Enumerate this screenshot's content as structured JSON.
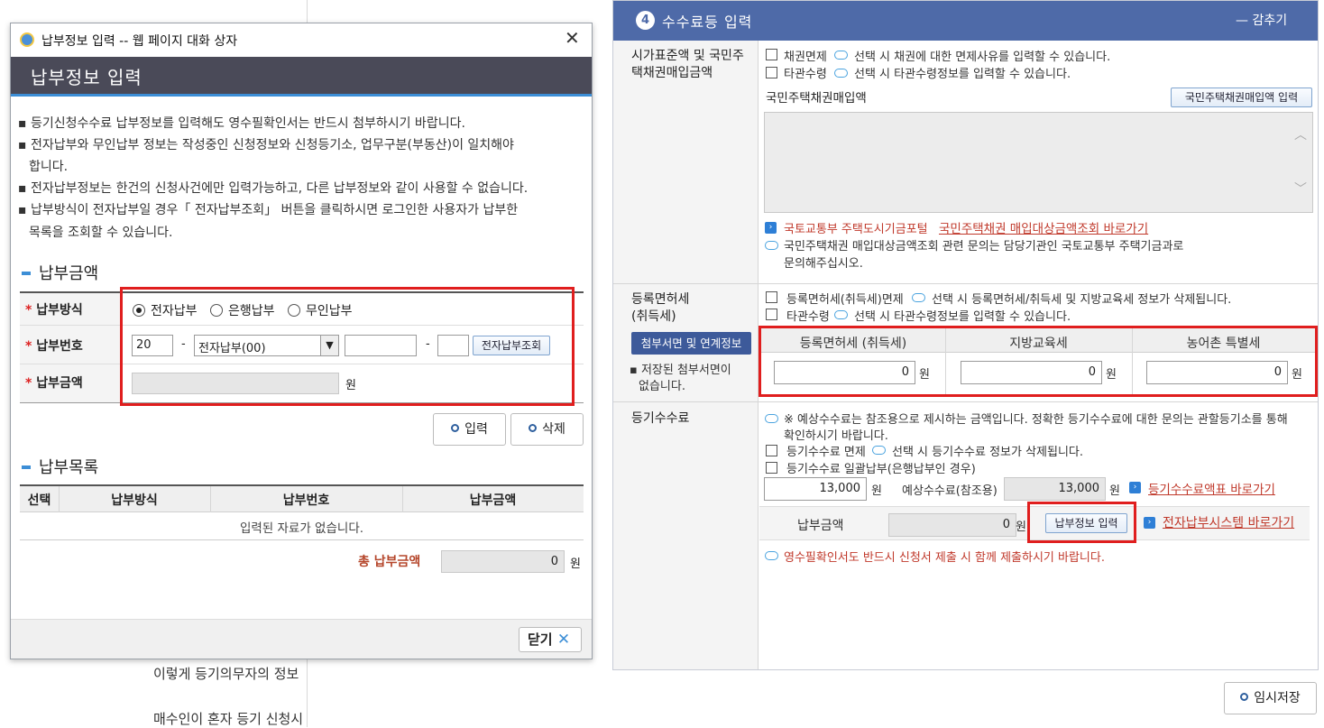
{
  "background": {
    "line1": "이렇게 등기의무자의 정보",
    "line2": "매수인이 혼자 등기 신청시"
  },
  "panel": {
    "step_number": "4",
    "title": "수수료등 입력",
    "collapse": "— 감추기",
    "sec1": {
      "label": "시가표준액 및 국민주택채권매입금액",
      "opt1": "채권면제",
      "opt1_desc": "선택 시 채권에 대한 면제사유를 입력할 수 있습니다.",
      "opt2": "타관수령",
      "opt2_desc": "선택 시 타관수령정보를 입력할 수 있습니다.",
      "sub_label": "국민주택채권매입액",
      "input_btn": "국민주택채권매입액 입력",
      "link_prefix": "국토교통부 주택도시기금포털",
      "link": "국민주택채권 매입대상금액조회 바로가기",
      "note1": "국민주택채권 매입대상금액조회 관련 문의는 담당기관인 국토교통부 주택기금과로",
      "note2": "문의해주십시오."
    },
    "sec2": {
      "label1": "등록면허세",
      "label2": "(취득세)",
      "opt1": "등록면허세(취득세)면제",
      "opt1_desc": "선택 시 등록면허세/취득세 및 지방교육세 정보가 삭제됩니다.",
      "opt2": "타관수령",
      "opt2_desc": "선택 시 타관수령정보를 입력할 수 있습니다.",
      "attach_btn": "첨부서면 및 연계정보",
      "saved_note1": "저장된 첨부서면이",
      "saved_note2": "없습니다.",
      "headers": [
        "등록면허세 (취득세)",
        "지방교육세",
        "농어촌 특별세"
      ],
      "values": [
        "0",
        "0",
        "0"
      ],
      "unit": "원"
    },
    "sec3": {
      "label": "등기수수료",
      "note1": "※ 예상수수료는 참조용으로 제시하는 금액입니다. 정확한 등기수수료에 대한 문의는 관할등기소를 통해",
      "note2": "확인하시기 바랍니다.",
      "opt1": "등기수수료 면제",
      "opt1_desc": "선택 시 등기수수료 정보가 삭제됩니다.",
      "opt2": "등기수수료 일괄납부(은행납부인 경우)",
      "fee_value": "13,000",
      "unit": "원",
      "expected_label": "예상수수료(참조용)",
      "expected_value": "13,000",
      "fee_table_link": "등기수수료액표 바로가기",
      "pay_label": "납부금액",
      "pay_value": "0",
      "pay_btn": "납부정보 입력",
      "epay_link": "전자납부시스템 바로가기",
      "bottom_note": "영수필확인서도 반드시 신청서 제출 시 함께 제출하시기 바랍니다."
    },
    "temp_save": "임시저장"
  },
  "dialog": {
    "window_title": "납부정보 입력 -- 웹 페이지 대화 상자",
    "header": "납부정보 입력",
    "bullets": [
      "등기신청수수료 납부정보를 입력해도 영수필확인서는 반드시 첨부하시기 바랍니다.",
      "전자납부와 무인납부 정보는 작성중인 신청정보와 신청등기소, 업무구분(부동산)이 일치해야",
      "합니다.",
      "전자납부정보는 한건의 신청사건에만 입력가능하고, 다른 납부정보와 같이 사용할 수 없습니다.",
      "납부방식이 전자납부일 경우「 전자납부조회」 버튼을 클릭하시면 로그인한 사용자가 납부한",
      "목록을 조회할 수 있습니다."
    ],
    "section1": "납부금액",
    "method_label": "납부방식",
    "methods": [
      "전자납부",
      "은행납부",
      "무인납부"
    ],
    "number_label": "납부번호",
    "number_prefix": "20",
    "number_select": "전자납부(00)",
    "lookup_btn": "전자납부조회",
    "amount_label": "납부금액",
    "amount_unit": "원",
    "btn_input": "입력",
    "btn_delete": "삭제",
    "section2": "납부목록",
    "list_headers": [
      "선택",
      "납부방식",
      "납부번호",
      "납부금액"
    ],
    "list_empty": "입력된 자료가 없습니다.",
    "total_label": "총 납부금액",
    "total_value": "0",
    "total_unit": "원",
    "close": "닫기"
  },
  "colors": {
    "header_blue": "#4e6aa8",
    "highlight_red": "#e01e1e",
    "dialog_bar": "#4a4a58"
  }
}
